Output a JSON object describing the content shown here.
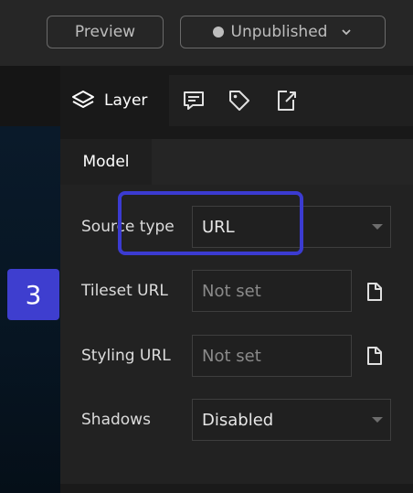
{
  "header": {
    "preview_label": "Preview",
    "publish_label": "Unpublished"
  },
  "panel": {
    "tabs": [
      {
        "label": "Layer",
        "icon": "layers-icon"
      },
      {
        "icon": "comment-icon"
      },
      {
        "icon": "tag-icon"
      },
      {
        "icon": "export-icon"
      }
    ],
    "subtab": "Model",
    "fields": {
      "source_type": {
        "label": "Source type",
        "value": "URL"
      },
      "tileset_url": {
        "label": "Tileset URL",
        "placeholder": "Not set"
      },
      "styling_url": {
        "label": "Styling URL",
        "placeholder": "Not set"
      },
      "shadows": {
        "label": "Shadows",
        "value": "Disabled"
      }
    }
  },
  "step_badge": "3",
  "colors": {
    "highlight": "#3b3bd1",
    "badge": "#3e3ecf"
  }
}
